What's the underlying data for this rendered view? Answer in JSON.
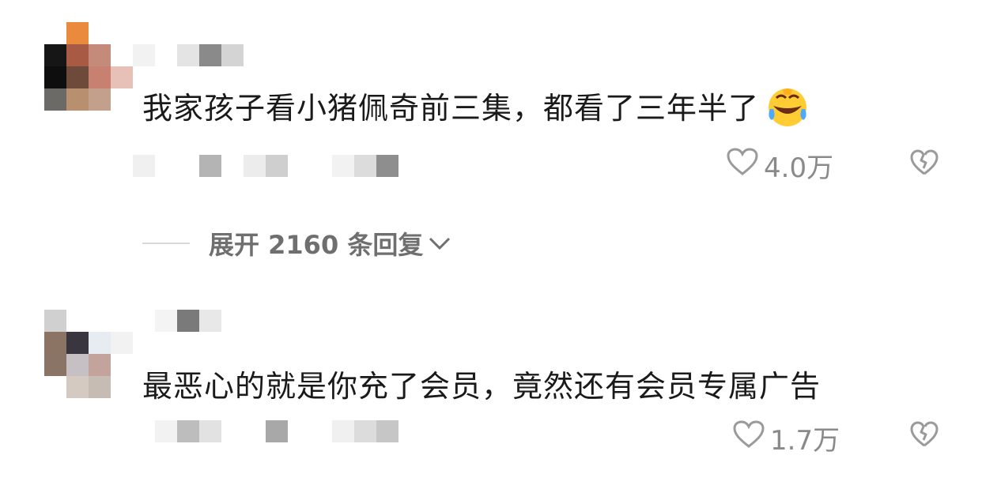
{
  "comments": [
    {
      "text": "我家孩子看小猪佩奇前三集，都看了三年半了",
      "emoji": "laughing-crying-emoji",
      "likes": "4.0万"
    },
    {
      "text": "最恶心的就是你充了会员，竟然还有会员专属广告",
      "likes": "1.7万"
    }
  ],
  "replies": {
    "expand_label": "展开 2160 条回复"
  },
  "icons": {
    "like": "heart-outline-icon",
    "dislike": "broken-heart-icon",
    "expand": "chevron-down-icon"
  },
  "colors": {
    "text": "#1a1a1a",
    "muted": "#8a8a8a",
    "expand": "#6f6f6f"
  }
}
